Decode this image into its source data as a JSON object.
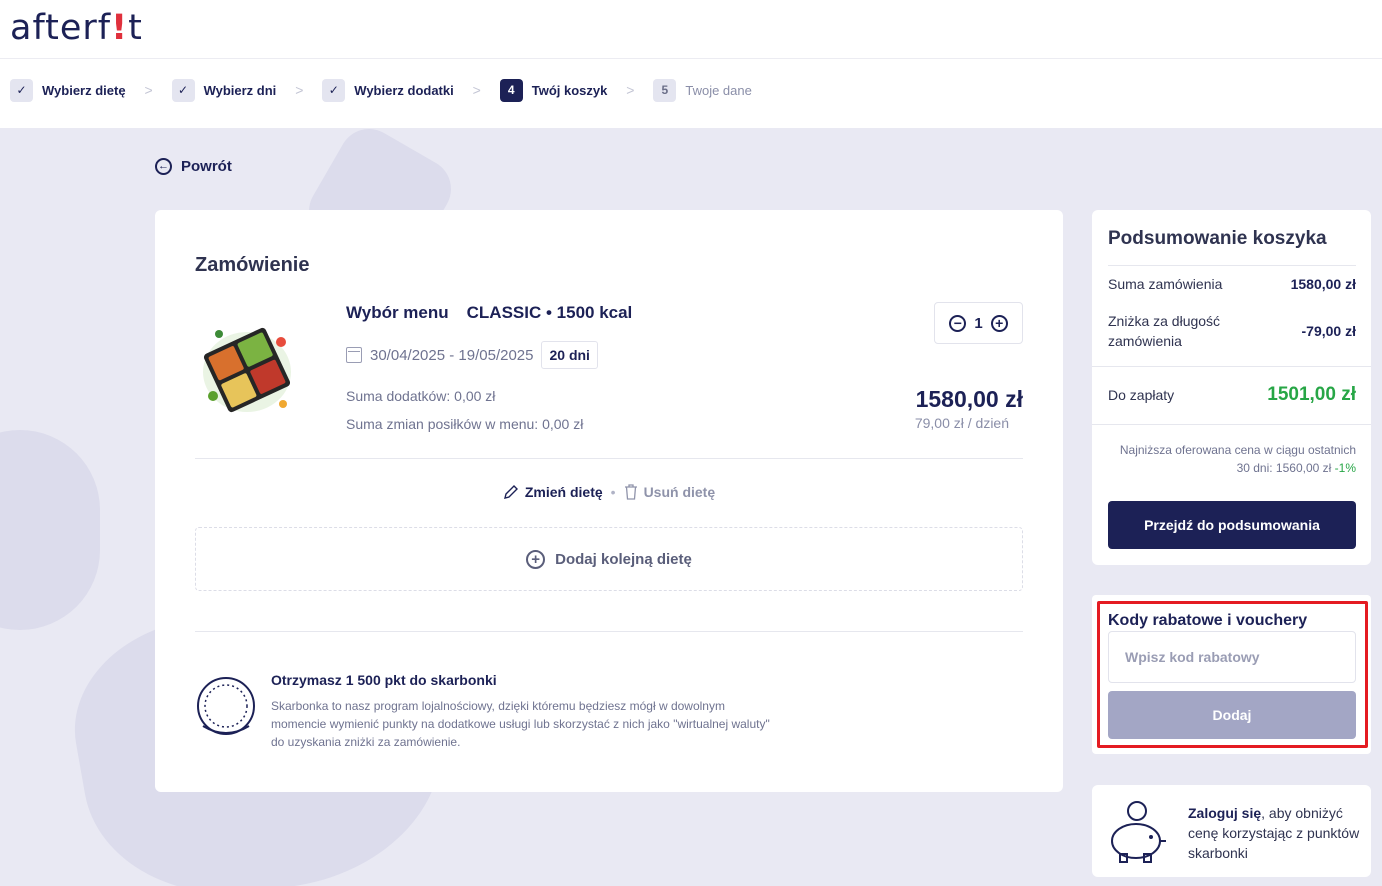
{
  "brand": {
    "logo_pre": "afterf",
    "logo_bang": "!",
    "logo_post": "t"
  },
  "steps": [
    {
      "label": "Wybierz dietę",
      "marker": "✓"
    },
    {
      "label": "Wybierz dni",
      "marker": "✓"
    },
    {
      "label": "Wybierz dodatki",
      "marker": "✓"
    },
    {
      "label": "Twój koszyk",
      "marker": "4"
    },
    {
      "label": "Twoje dane",
      "marker": "5"
    }
  ],
  "step_separator": ">",
  "back": {
    "label": "Powrót",
    "icon": "arrow-left-circle-icon"
  },
  "order": {
    "title": "Zamówienie",
    "menu_label": "Wybór menu",
    "diet": "CLASSIC • 1500 kcal",
    "date_range": "30/04/2025 - 19/05/2025",
    "days": "20 dni",
    "addons_sum": "Suma dodatków:  0,00 zł",
    "meal_changes_sum": "Suma zmian posiłków w menu:  0,00 zł",
    "quantity": "1",
    "price": "1580,00 zł",
    "per_day": "79,00 zł / dzień",
    "change_diet": "Zmień dietę",
    "remove_diet": "Usuń dietę",
    "action_sep": "•",
    "add_another": "Dodaj kolejną dietę",
    "loyalty_title": "Otrzymasz 1 500 pkt do skarbonki",
    "loyalty_text": "Skarbonka to nasz program lojalnościowy, dzięki któremu będziesz mógł w dowolnym momencie wymienić punkty na dodatkowe usługi lub skorzystać z nich jako \"wirtualnej waluty\" do uzyskania zniżki za zamówienie."
  },
  "summary": {
    "title": "Podsumowanie koszyka",
    "order_sum_label": "Suma zamówienia",
    "order_sum_value": "1580,00 zł",
    "discount_label": "Zniżka za długość zamówienia",
    "discount_value": "-79,00 zł",
    "to_pay_label": "Do zapłaty",
    "to_pay_value": "1501,00 zł",
    "lowest_price_text": "Najniższa oferowana cena w ciągu ostatnich 30 dni: 1560,00 zł",
    "lowest_price_pct": "-1%",
    "proceed_button": "Przejdź do podsumowania"
  },
  "voucher": {
    "title": "Kody rabatowe i vouchery",
    "placeholder": "Wpisz kod rabatowy",
    "add_button": "Dodaj"
  },
  "login_promo": {
    "link": "Zaloguj się",
    "text": ", aby obniżyć cenę korzystając z punktów skarbonki"
  },
  "colors": {
    "navy": "#1c2156",
    "green": "#27a646",
    "highlight_red": "#e41b22",
    "disabled_button": "#a3a6c5",
    "background": "#e9e9f3"
  }
}
